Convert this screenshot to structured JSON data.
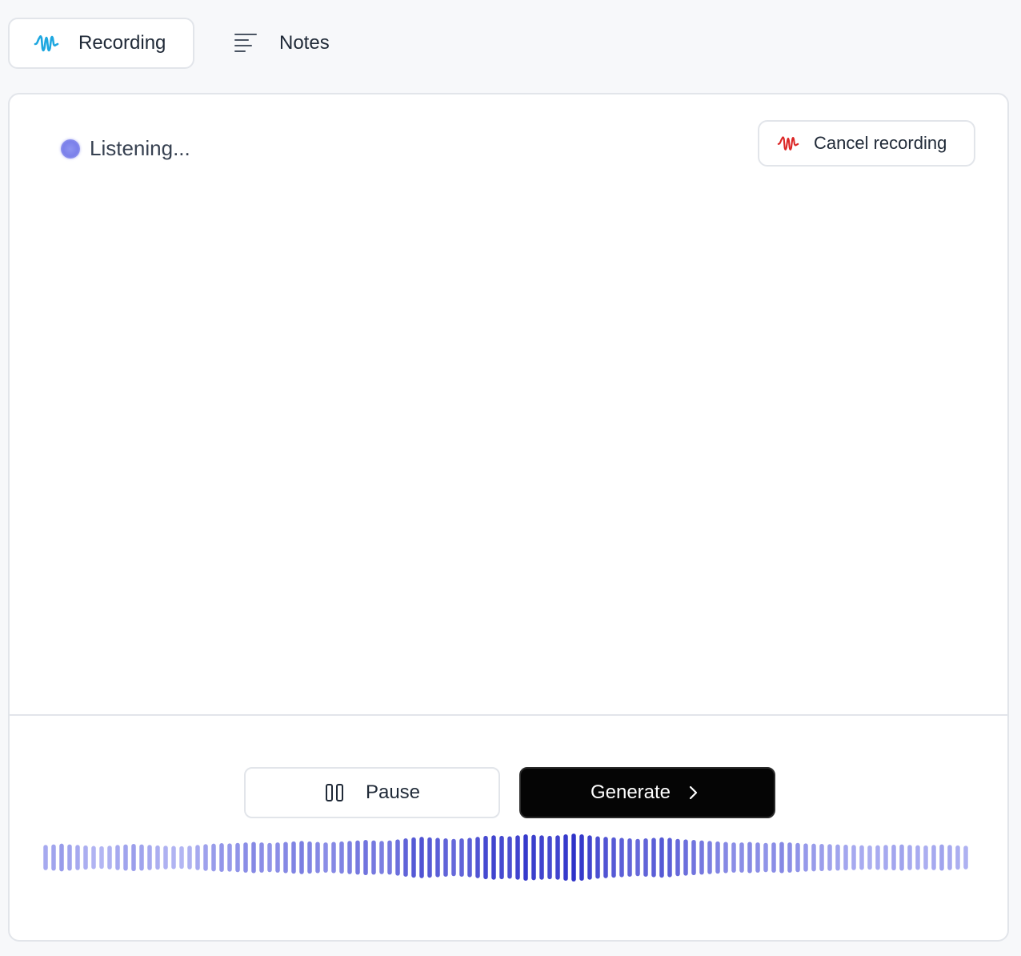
{
  "tabs": [
    {
      "label": "Recording",
      "icon": "waveform-icon",
      "active": true,
      "icon_color": "#1ea7e0"
    },
    {
      "label": "Notes",
      "icon": "text-lines-icon",
      "active": false
    }
  ],
  "status": {
    "text": "Listening...",
    "dot_color": "#7b80ea"
  },
  "cancel": {
    "label": "Cancel recording",
    "icon": "waveform-icon",
    "icon_color": "#dc2626"
  },
  "controls": {
    "pause_label": "Pause",
    "pause_icon": "pause-icon",
    "generate_label": "Generate",
    "generate_icon": "chevron-right-icon"
  },
  "waveform": {
    "bar_count": 116,
    "levels": [
      0.5,
      0.52,
      0.55,
      0.52,
      0.5,
      0.48,
      0.46,
      0.45,
      0.47,
      0.5,
      0.52,
      0.54,
      0.52,
      0.5,
      0.48,
      0.47,
      0.46,
      0.45,
      0.47,
      0.5,
      0.53,
      0.55,
      0.57,
      0.56,
      0.58,
      0.6,
      0.62,
      0.6,
      0.58,
      0.6,
      0.62,
      0.64,
      0.66,
      0.64,
      0.62,
      0.6,
      0.62,
      0.64,
      0.66,
      0.68,
      0.7,
      0.68,
      0.66,
      0.68,
      0.72,
      0.76,
      0.8,
      0.82,
      0.8,
      0.78,
      0.76,
      0.74,
      0.76,
      0.78,
      0.82,
      0.86,
      0.88,
      0.86,
      0.84,
      0.88,
      0.92,
      0.9,
      0.88,
      0.86,
      0.88,
      0.92,
      0.95,
      0.92,
      0.88,
      0.84,
      0.82,
      0.8,
      0.78,
      0.76,
      0.74,
      0.76,
      0.78,
      0.8,
      0.78,
      0.74,
      0.72,
      0.7,
      0.68,
      0.66,
      0.64,
      0.62,
      0.6,
      0.6,
      0.62,
      0.6,
      0.58,
      0.6,
      0.62,
      0.6,
      0.58,
      0.56,
      0.55,
      0.54,
      0.53,
      0.52,
      0.51,
      0.5,
      0.49,
      0.48,
      0.49,
      0.5,
      0.51,
      0.52,
      0.5,
      0.49,
      0.48,
      0.5,
      0.52,
      0.5,
      0.48,
      0.47
    ],
    "color_light": "#b3b6f3",
    "color_dark": "#2e32c8"
  }
}
